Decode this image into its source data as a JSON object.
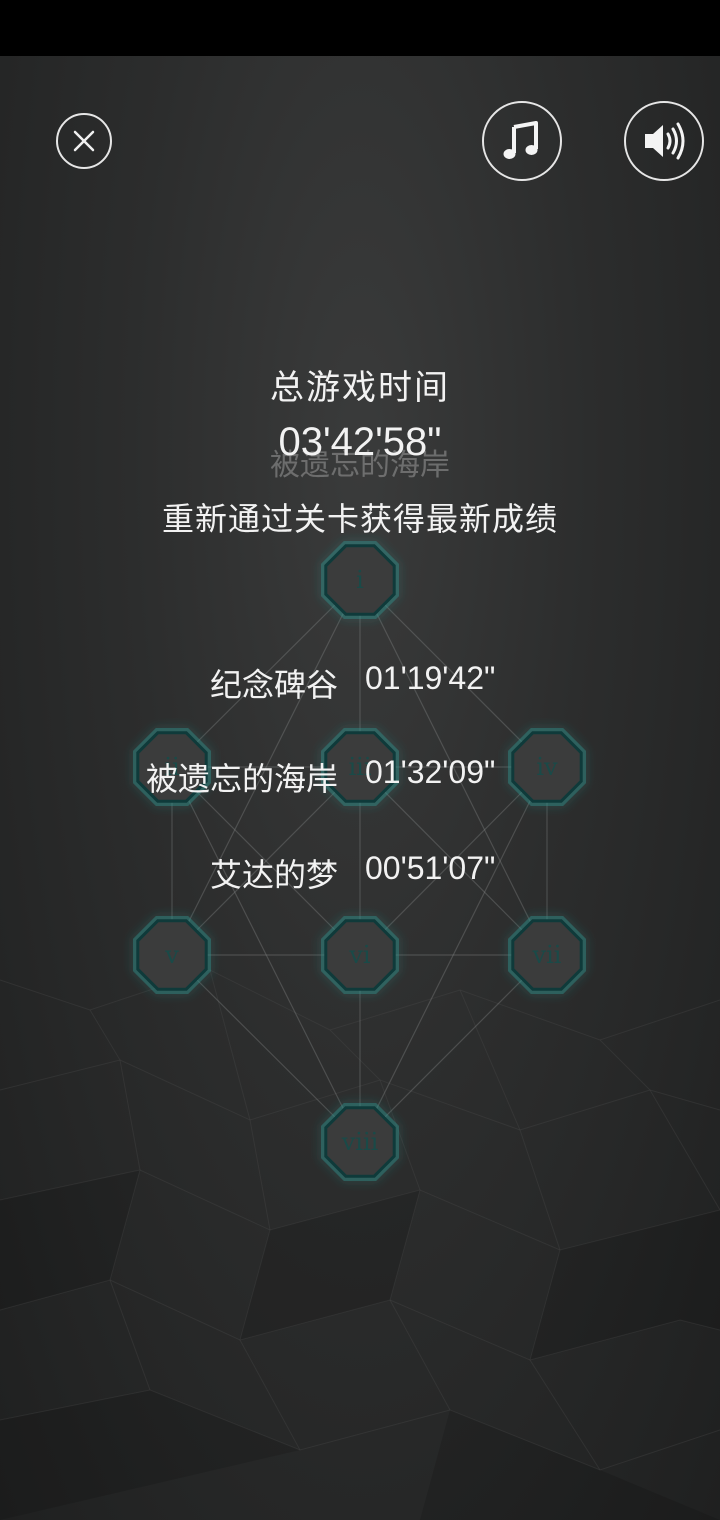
{
  "header": {
    "icons": {
      "close": "close-icon",
      "music": "music-note-icon",
      "sound": "speaker-icon"
    }
  },
  "summary": {
    "total_label": "总游戏时间",
    "total_time": "03'42'58\"",
    "ghost_title": "被遗忘的海岸",
    "hint": "重新通过关卡获得最新成绩"
  },
  "levels": [
    {
      "label": "i"
    },
    {
      "label": "ii"
    },
    {
      "label": "iii"
    },
    {
      "label": "iv"
    },
    {
      "label": "v"
    },
    {
      "label": "vi"
    },
    {
      "label": "vii"
    },
    {
      "label": "viii"
    }
  ],
  "records": [
    {
      "name": "纪念碑谷",
      "time": "01'19'42\""
    },
    {
      "name": "被遗忘的海岸",
      "time": "01'32'09\""
    },
    {
      "name": "艾达的梦",
      "time": "00'51'07\""
    }
  ],
  "colors": {
    "background": "#2c2d2d",
    "node_fill": "#3b3c3c",
    "node_stroke": "#0f3a3a",
    "node_glow": "#2f8f8a",
    "text": "#f2f2f2"
  }
}
